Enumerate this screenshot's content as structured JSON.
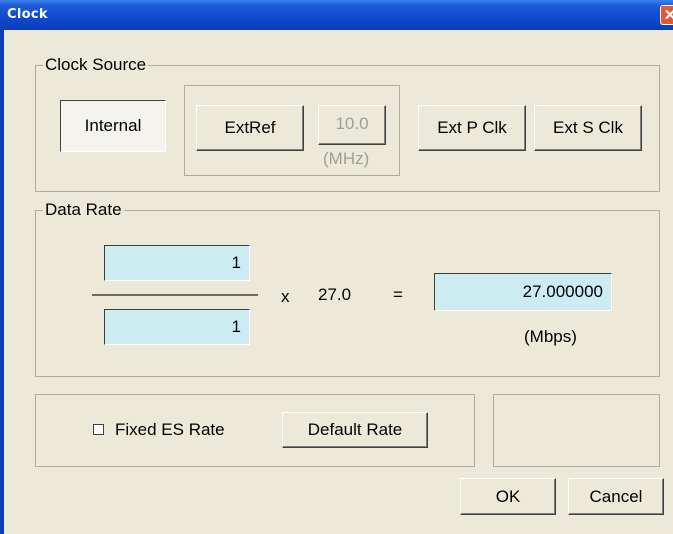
{
  "window": {
    "title": "Clock",
    "close_glyph": "✕"
  },
  "clock_source": {
    "legend": "Clock Source",
    "internal_label": "Internal",
    "extref_label": "ExtRef",
    "extref_freq_value": "10.0",
    "extref_freq_unit": "(MHz)",
    "ext_p_clk_label": "Ext P Clk",
    "ext_s_clk_label": "Ext S Clk",
    "selected": "Internal"
  },
  "data_rate": {
    "legend": "Data Rate",
    "numerator": "1",
    "denominator": "1",
    "multiply_sign": "x",
    "base_rate": "27.0",
    "equals_sign": "=",
    "result": "27.000000",
    "result_unit": "(Mbps)"
  },
  "options": {
    "fixed_es_rate_label": "Fixed ES Rate",
    "fixed_es_rate_checked": false,
    "default_rate_label": "Default Rate"
  },
  "footer": {
    "ok_label": "OK",
    "cancel_label": "Cancel"
  }
}
